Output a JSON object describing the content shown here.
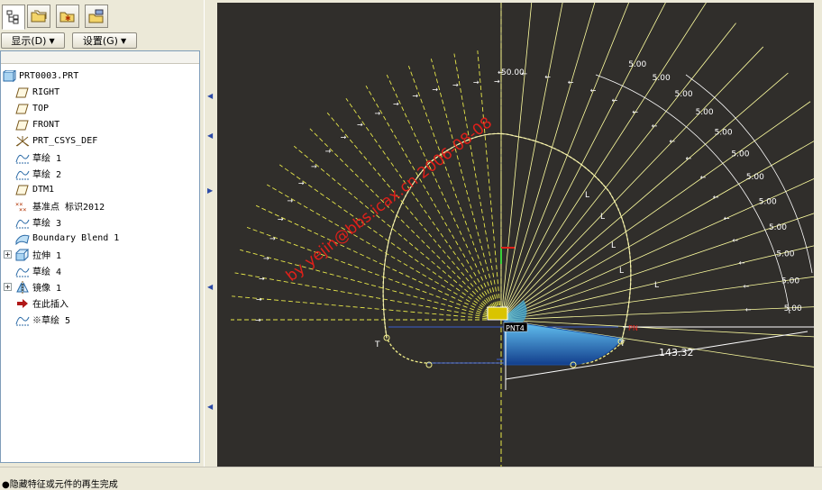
{
  "left_panel": {
    "menu": {
      "display_label": "显示(D)",
      "settings_label": "设置(G)"
    },
    "tree": {
      "items": [
        {
          "label": "PRT0003.PRT",
          "icon": "part-icon"
        },
        {
          "label": "RIGHT",
          "icon": "datum-plane-icon"
        },
        {
          "label": "TOP",
          "icon": "datum-plane-icon"
        },
        {
          "label": "FRONT",
          "icon": "datum-plane-icon"
        },
        {
          "label": "PRT_CSYS_DEF",
          "icon": "csys-icon"
        },
        {
          "label": "草绘 1",
          "icon": "sketch-icon"
        },
        {
          "label": "草绘 2",
          "icon": "sketch-icon"
        },
        {
          "label": "DTM1",
          "icon": "datum-plane-icon"
        },
        {
          "label": "基准点 标识2012",
          "icon": "datum-point-icon"
        },
        {
          "label": "草绘 3",
          "icon": "sketch-icon"
        },
        {
          "label": "Boundary Blend 1",
          "icon": "boundary-blend-icon"
        },
        {
          "label": "拉伸 1",
          "icon": "extrude-icon"
        },
        {
          "label": "草绘 4",
          "icon": "sketch-icon"
        },
        {
          "label": "镜像 1",
          "icon": "mirror-icon"
        },
        {
          "label": "在此插入",
          "icon": "insert-here-arrow-icon"
        },
        {
          "label": "※草绘 5",
          "icon": "sketch-icon"
        }
      ]
    }
  },
  "graphics": {
    "watermark": "by yejin@bbs.icax.cn 2006-08-08",
    "dimension_label": "5.00",
    "dimension_143": "143.32",
    "top_dimension": "50.00",
    "point_label": "PNT4",
    "point_label_right": "PN",
    "constraint_L": "L",
    "constraint_T": "T",
    "colors": {
      "background": "#302e2b",
      "dashed_lines": "#e8e84a",
      "constraint_lines": "#ffffa0",
      "watermark": "#e0201a",
      "surface": "#2f8fd8"
    }
  },
  "status_bar": {
    "message": "●隐藏特征或元件的再生完成"
  }
}
